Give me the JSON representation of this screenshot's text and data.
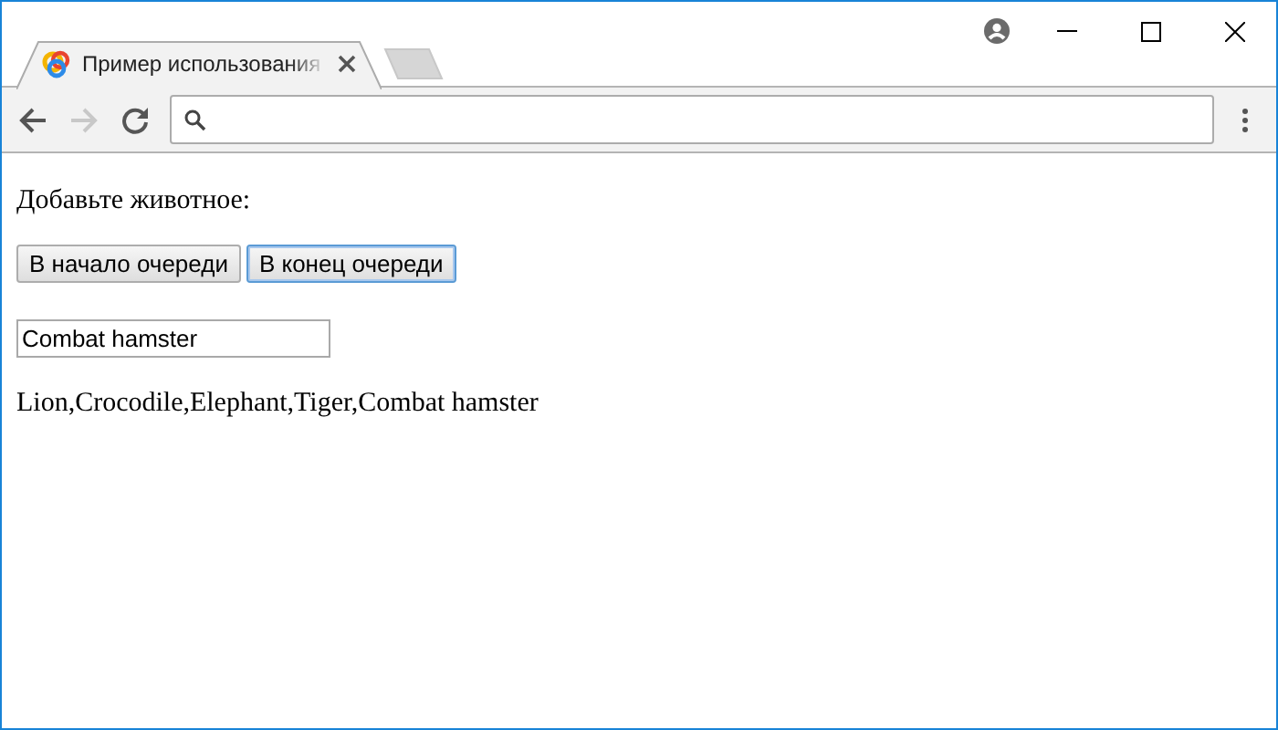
{
  "tab": {
    "title": "Пример использования",
    "selected": true
  },
  "navigation": {
    "back_enabled": true,
    "forward_enabled": false
  },
  "page": {
    "prompt": "Добавьте животное:",
    "buttons": [
      {
        "label": "В начало очереди",
        "focused": false
      },
      {
        "label": "В конец очереди",
        "focused": true
      }
    ],
    "input": {
      "value": "Combat hamster"
    },
    "output": "Lion,Crocodile,Elephant,Tiger,Combat hamster"
  }
}
